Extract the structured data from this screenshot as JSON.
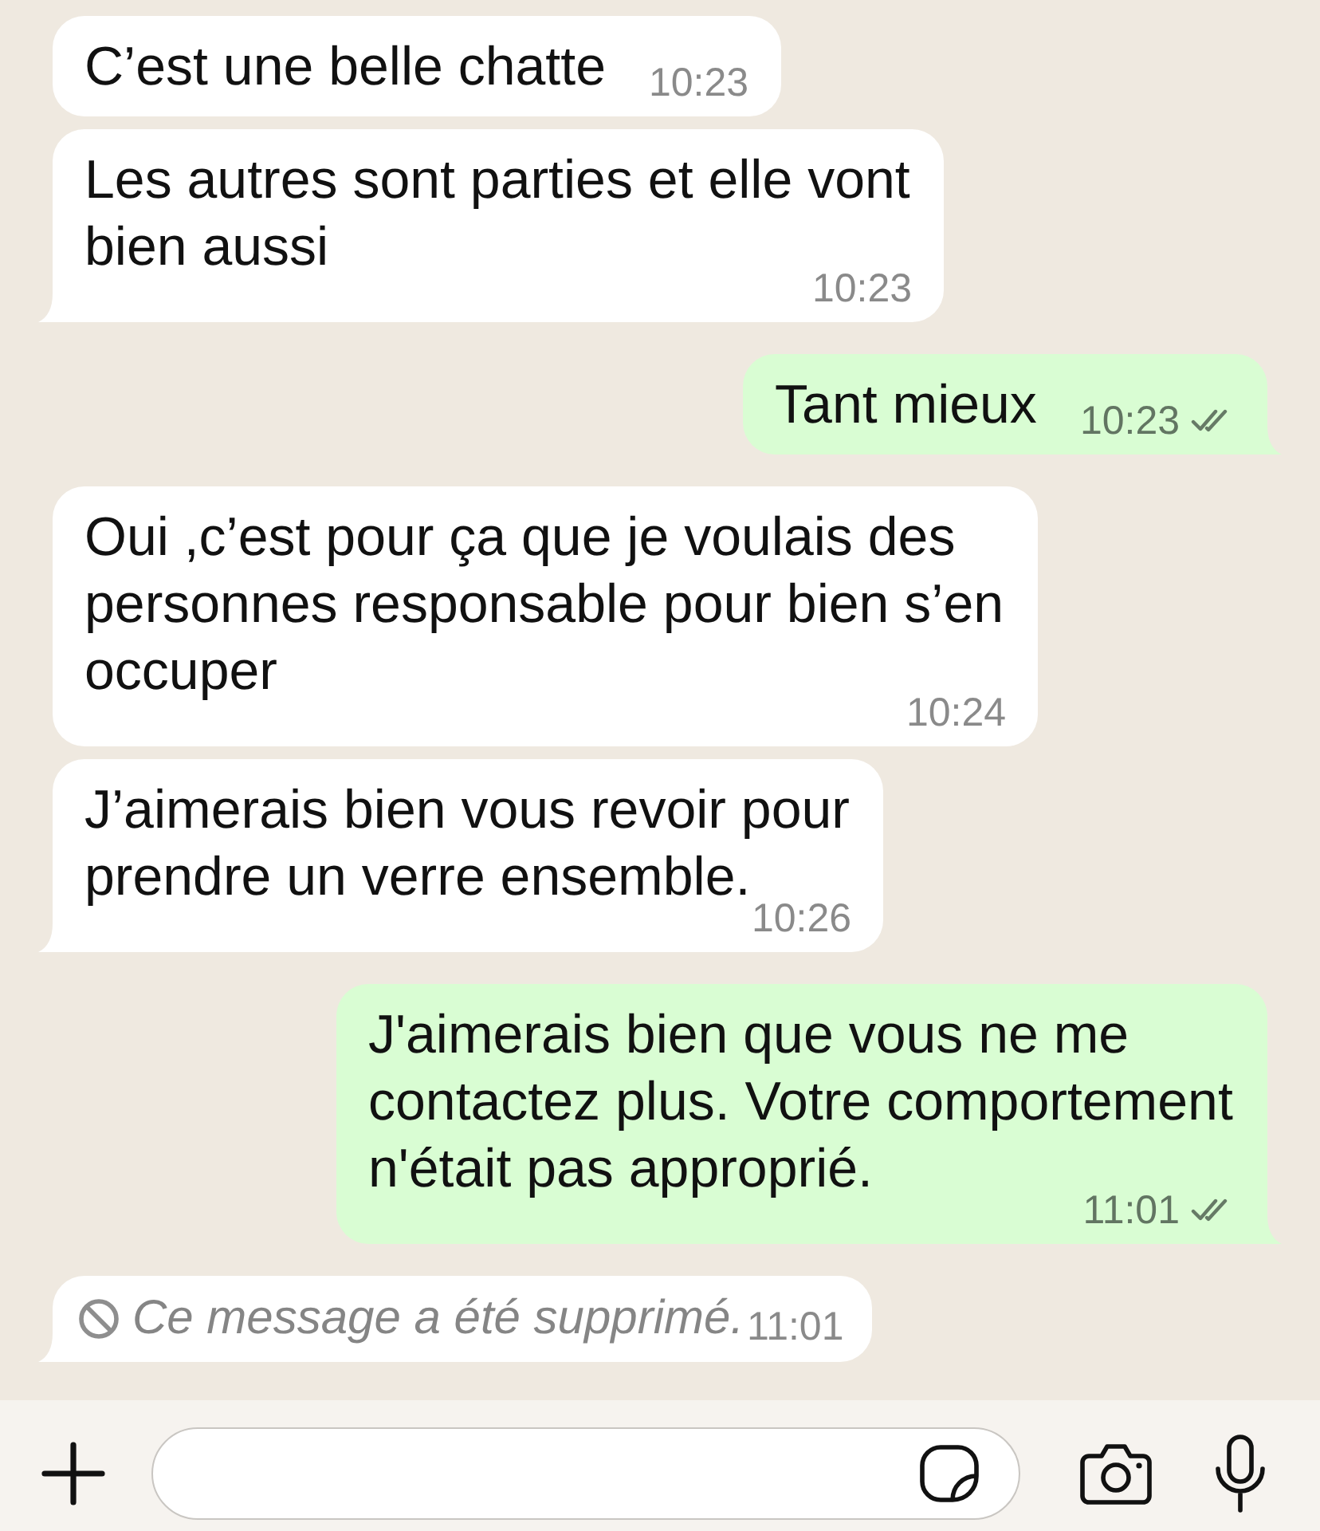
{
  "messages": [
    {
      "kind": "text",
      "outgoing": false,
      "text": "C’est une belle chatte",
      "time": "10:23"
    },
    {
      "kind": "text",
      "outgoing": false,
      "text": "Les autres sont parties et elle vont bien aussi",
      "time": "10:23"
    },
    {
      "kind": "text",
      "outgoing": true,
      "text": "Tant mieux",
      "time": "10:23",
      "read": false
    },
    {
      "kind": "text",
      "outgoing": false,
      "text": "Oui ,c’est pour ça que je voulais des personnes responsable pour bien s’en occuper",
      "time": "10:24"
    },
    {
      "kind": "text",
      "outgoing": false,
      "text": "J’aimerais bien vous revoir pour prendre un verre ensemble.",
      "time": "10:26"
    },
    {
      "kind": "text",
      "outgoing": true,
      "text": "J'aimerais bien que vous ne me contactez plus. Votre comportement n'était pas approprié.",
      "time": "11:01",
      "read": false
    },
    {
      "kind": "deleted",
      "outgoing": false,
      "text": "Ce message a été supprimé.",
      "time": "11:01"
    }
  ]
}
